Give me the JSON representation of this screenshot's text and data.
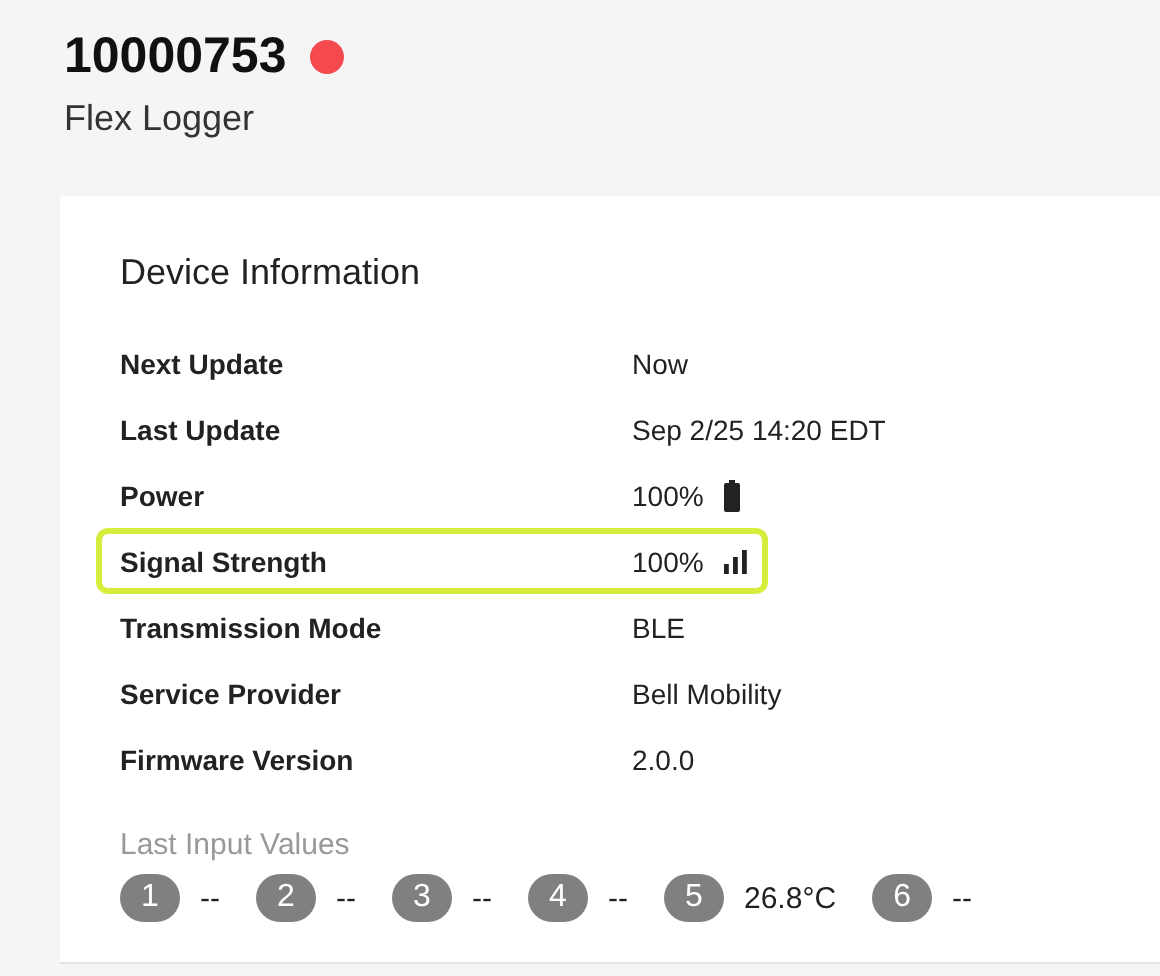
{
  "device": {
    "id": "10000753",
    "color": "#f4494f",
    "type": "Flex Logger"
  },
  "card": {
    "title": "Device Information",
    "rows": [
      {
        "label": "Next Update",
        "value": "Now",
        "kind": "text",
        "highlighted": false
      },
      {
        "label": "Last Update",
        "value": "Sep 2/25 14:20 EDT",
        "kind": "text",
        "highlighted": false
      },
      {
        "label": "Power",
        "value": "100%",
        "kind": "battery",
        "highlighted": false
      },
      {
        "label": "Signal Strength",
        "value": "100%",
        "kind": "signal",
        "highlighted": true
      },
      {
        "label": "Transmission Mode",
        "value": "BLE",
        "kind": "text",
        "highlighted": false
      },
      {
        "label": "Service Provider",
        "value": "Bell Mobility",
        "kind": "text",
        "highlighted": false
      },
      {
        "label": "Firmware Version",
        "value": "2.0.0",
        "kind": "text",
        "highlighted": false
      }
    ],
    "inputs_title": "Last Input Values",
    "inputs": [
      {
        "number": "1",
        "value": "--"
      },
      {
        "number": "2",
        "value": "--"
      },
      {
        "number": "3",
        "value": "--"
      },
      {
        "number": "4",
        "value": "--"
      },
      {
        "number": "5",
        "value": "26.8°C"
      },
      {
        "number": "6",
        "value": "--"
      }
    ]
  }
}
